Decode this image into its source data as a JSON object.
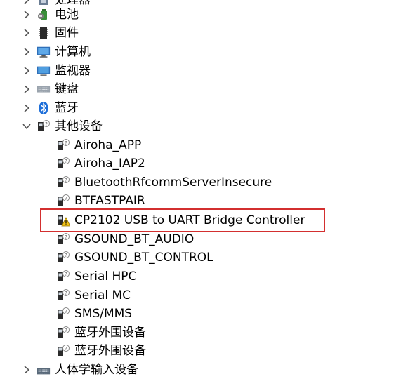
{
  "tree": {
    "top_partial": {
      "label": "处理器"
    },
    "battery": {
      "label": "电池"
    },
    "firmware": {
      "label": "固件"
    },
    "computer": {
      "label": "计算机"
    },
    "monitor": {
      "label": "监视器"
    },
    "keyboard": {
      "label": "键盘"
    },
    "bluetooth": {
      "label": "蓝牙"
    },
    "other_devices": {
      "label": "其他设备",
      "expanded": true,
      "children": [
        {
          "label": "Airoha_APP",
          "warning": false
        },
        {
          "label": "Airoha_IAP2",
          "warning": false
        },
        {
          "label": "BluetoothRfcommServerInsecure",
          "warning": false
        },
        {
          "label": "BTFASTPAIR",
          "warning": false
        },
        {
          "label": "CP2102 USB to UART Bridge Controller",
          "warning": true
        },
        {
          "label": "GSOUND_BT_AUDIO",
          "warning": false
        },
        {
          "label": "GSOUND_BT_CONTROL",
          "warning": false
        },
        {
          "label": "Serial HPC",
          "warning": false
        },
        {
          "label": "Serial MC",
          "warning": false
        },
        {
          "label": "SMS/MMS",
          "warning": false
        },
        {
          "label": "蓝牙外围设备",
          "warning": false
        },
        {
          "label": "蓝牙外围设备",
          "warning": false
        }
      ]
    },
    "hid": {
      "label": "人体学输入设备"
    }
  },
  "colors": {
    "highlight_border": "#d32f2f",
    "chevron": "#555555",
    "bluetooth_blue": "#1e6fd9",
    "warning_yellow": "#f5c518"
  }
}
